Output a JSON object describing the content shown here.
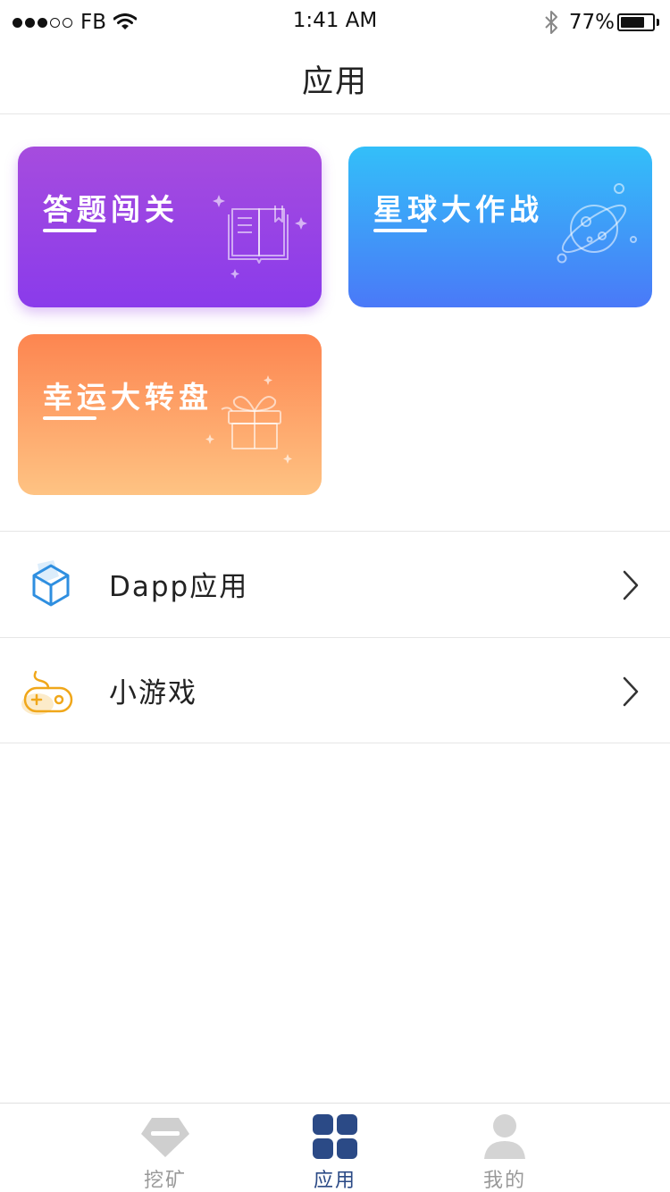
{
  "status_bar": {
    "carrier": "FB",
    "time": "1:41 AM",
    "battery_percent": "77%",
    "battery_level": 0.77
  },
  "header": {
    "title": "应用"
  },
  "cards": [
    {
      "id": "quiz",
      "title": "答题闯关",
      "icon": "book-icon",
      "colors": [
        "#a64cde",
        "#8a3beb"
      ]
    },
    {
      "id": "planet",
      "title": "星球大作战",
      "icon": "planet-icon",
      "colors": [
        "#33bff9",
        "#4a79f8"
      ]
    },
    {
      "id": "wheel",
      "title": "幸运大转盘",
      "icon": "gift-icon",
      "colors": [
        "#fd8550",
        "#fec383"
      ]
    }
  ],
  "list": [
    {
      "label": "Dapp应用",
      "icon": "cube-icon"
    },
    {
      "label": "小游戏",
      "icon": "gamepad-icon"
    }
  ],
  "tabs": [
    {
      "label": "挖矿",
      "icon": "diamond-icon",
      "active": false
    },
    {
      "label": "应用",
      "icon": "grid-icon",
      "active": true
    },
    {
      "label": "我的",
      "icon": "user-icon",
      "active": false
    }
  ],
  "colors": {
    "accent": "#2b4a86",
    "inactive": "#999999"
  }
}
